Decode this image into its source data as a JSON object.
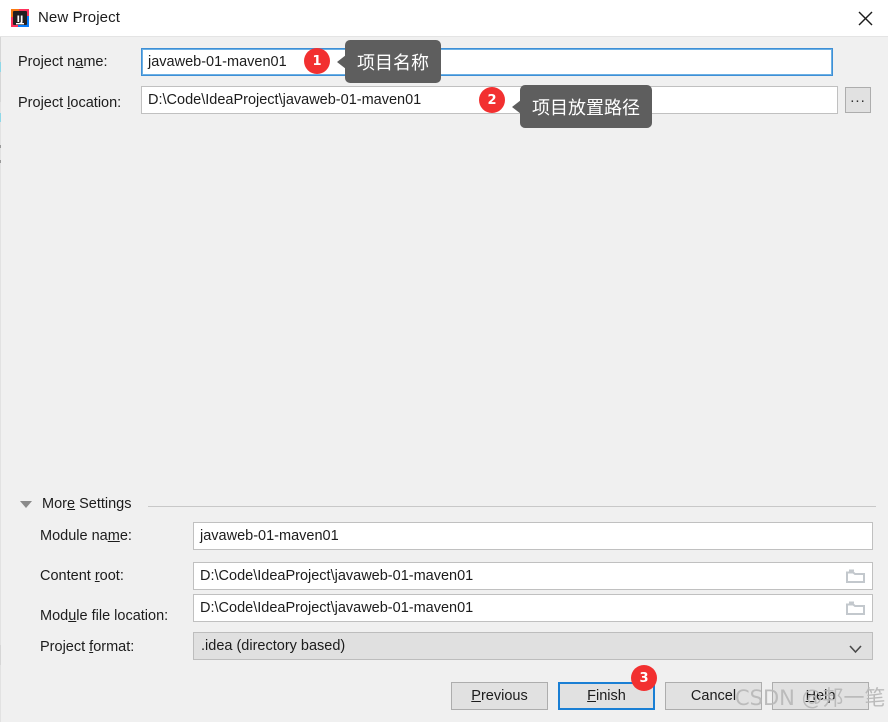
{
  "window": {
    "title": "New Project",
    "app_icon": "intellij-idea-icon",
    "close_icon": "close-icon"
  },
  "form": {
    "project_name": {
      "label_prefix": "Project n",
      "label_mnemonic": "a",
      "label_suffix": "me:",
      "value": "javaweb-01-maven01",
      "placeholder": "Project name"
    },
    "project_location": {
      "label_prefix": "Project ",
      "label_mnemonic": "l",
      "label_suffix": "ocation:",
      "value": "D:\\Code\\IdeaProject\\javaweb-01-maven01",
      "placeholder": "Project location",
      "browse_label": "..."
    }
  },
  "annotations": {
    "badge1": "1",
    "badge2": "2",
    "badge3": "3",
    "tooltip1": "项目名称",
    "tooltip2": "项目放置路径"
  },
  "more_settings": {
    "header_prefix": "Mor",
    "header_mnemonic": "e",
    "header_suffix": " Settings",
    "rows": [
      {
        "label_prefix": "Module na",
        "label_mnemonic": "m",
        "label_suffix": "e:",
        "value": "javaweb-01-maven01",
        "placeholder": "Module name",
        "has_folder": false
      },
      {
        "label_prefix": "Content ",
        "label_mnemonic": "r",
        "label_suffix": "oot:",
        "value": "D:\\Code\\IdeaProject\\javaweb-01-maven01",
        "placeholder": "Content root",
        "has_folder": true
      },
      {
        "label_prefix": "Mod",
        "label_mnemonic": "u",
        "label_suffix": "le file location:",
        "value": "D:\\Code\\IdeaProject\\javaweb-01-maven01",
        "placeholder": "Module file location",
        "has_folder": true
      }
    ],
    "project_format": {
      "label_prefix": "Project ",
      "label_mnemonic": "f",
      "label_suffix": "ormat:",
      "value": ".idea (directory based)",
      "chevron_icon": "chevron-down-icon"
    }
  },
  "buttons": {
    "previous": {
      "prefix": "",
      "mnemonic": "P",
      "suffix": "revious"
    },
    "finish": {
      "prefix": "",
      "mnemonic": "F",
      "suffix": "inish"
    },
    "cancel": {
      "prefix": "Cancel",
      "mnemonic": "",
      "suffix": ""
    },
    "help": {
      "prefix": "",
      "mnemonic": "H",
      "suffix": "elp"
    }
  },
  "watermark": {
    "text": "CSDN @邦一笔"
  },
  "colors": {
    "accent_blue": "#1a7fd4",
    "badge_red": "#f23030",
    "tooltip_gray": "#5e5e5e",
    "dialog_bg": "#f0f0f0"
  }
}
